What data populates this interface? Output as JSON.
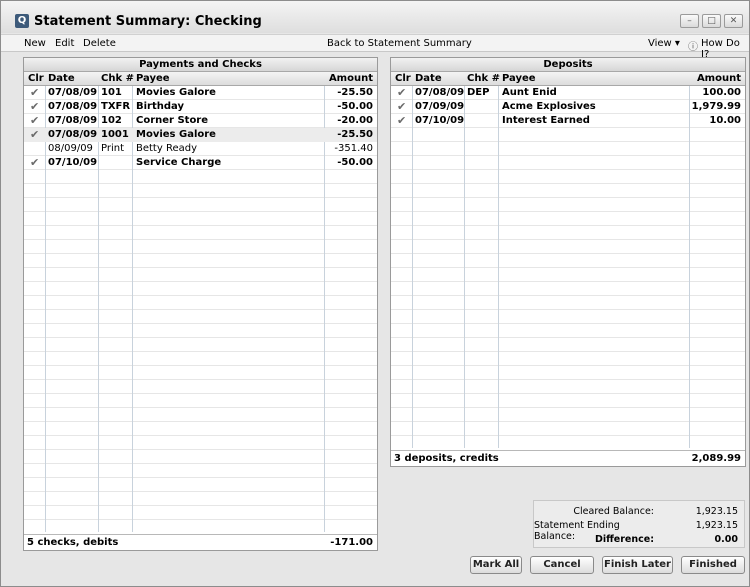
{
  "window": {
    "title": "Statement Summary: Checking"
  },
  "menu": {
    "new": "New",
    "edit": "Edit",
    "delete": "Delete",
    "back": "Back to Statement Summary",
    "view": "View ▾",
    "howdoi": "How Do I?"
  },
  "payments": {
    "title": "Payments and Checks",
    "columns": {
      "clr": "Clr",
      "date": "Date",
      "chk": "Chk #",
      "payee": "Payee",
      "amount": "Amount"
    },
    "rows": [
      {
        "cleared": true,
        "date": "07/08/09",
        "chk": "101",
        "payee": "Movies Galore",
        "amount": "-25.50"
      },
      {
        "cleared": true,
        "date": "07/08/09",
        "chk": "TXFR",
        "payee": "Birthday",
        "amount": "-50.00"
      },
      {
        "cleared": true,
        "date": "07/08/09",
        "chk": "102",
        "payee": "Corner Store",
        "amount": "-20.00"
      },
      {
        "cleared": true,
        "date": "07/08/09",
        "chk": "1001",
        "payee": "Movies Galore",
        "amount": "-25.50"
      },
      {
        "cleared": false,
        "date": "08/09/09",
        "chk": "Print",
        "payee": "Betty Ready",
        "amount": "-351.40"
      },
      {
        "cleared": true,
        "date": "07/10/09",
        "chk": "",
        "payee": "Service Charge",
        "amount": "-50.00"
      }
    ],
    "footer_label": "5 checks, debits",
    "footer_total": "-171.00"
  },
  "deposits": {
    "title": "Deposits",
    "columns": {
      "clr": "Clr",
      "date": "Date",
      "chk": "Chk #",
      "payee": "Payee",
      "amount": "Amount"
    },
    "rows": [
      {
        "cleared": true,
        "date": "07/08/09",
        "chk": "DEP",
        "payee": "Aunt Enid",
        "amount": "100.00"
      },
      {
        "cleared": true,
        "date": "07/09/09",
        "chk": "",
        "payee": "Acme Explosives",
        "amount": "1,979.99"
      },
      {
        "cleared": true,
        "date": "07/10/09",
        "chk": "",
        "payee": "Interest Earned",
        "amount": "10.00"
      }
    ],
    "footer_label": "3 deposits, credits",
    "footer_total": "2,089.99"
  },
  "summary": {
    "cleared_label": "Cleared Balance:",
    "cleared_value": "1,923.15",
    "ending_label": "Statement Ending Balance:",
    "ending_value": "1,923.15",
    "diff_label": "Difference:",
    "diff_value": "0.00"
  },
  "buttons": {
    "mark_all": "Mark All",
    "cancel": "Cancel",
    "finish_later": "Finish Later",
    "finished": "Finished"
  },
  "check_glyph": "✔"
}
